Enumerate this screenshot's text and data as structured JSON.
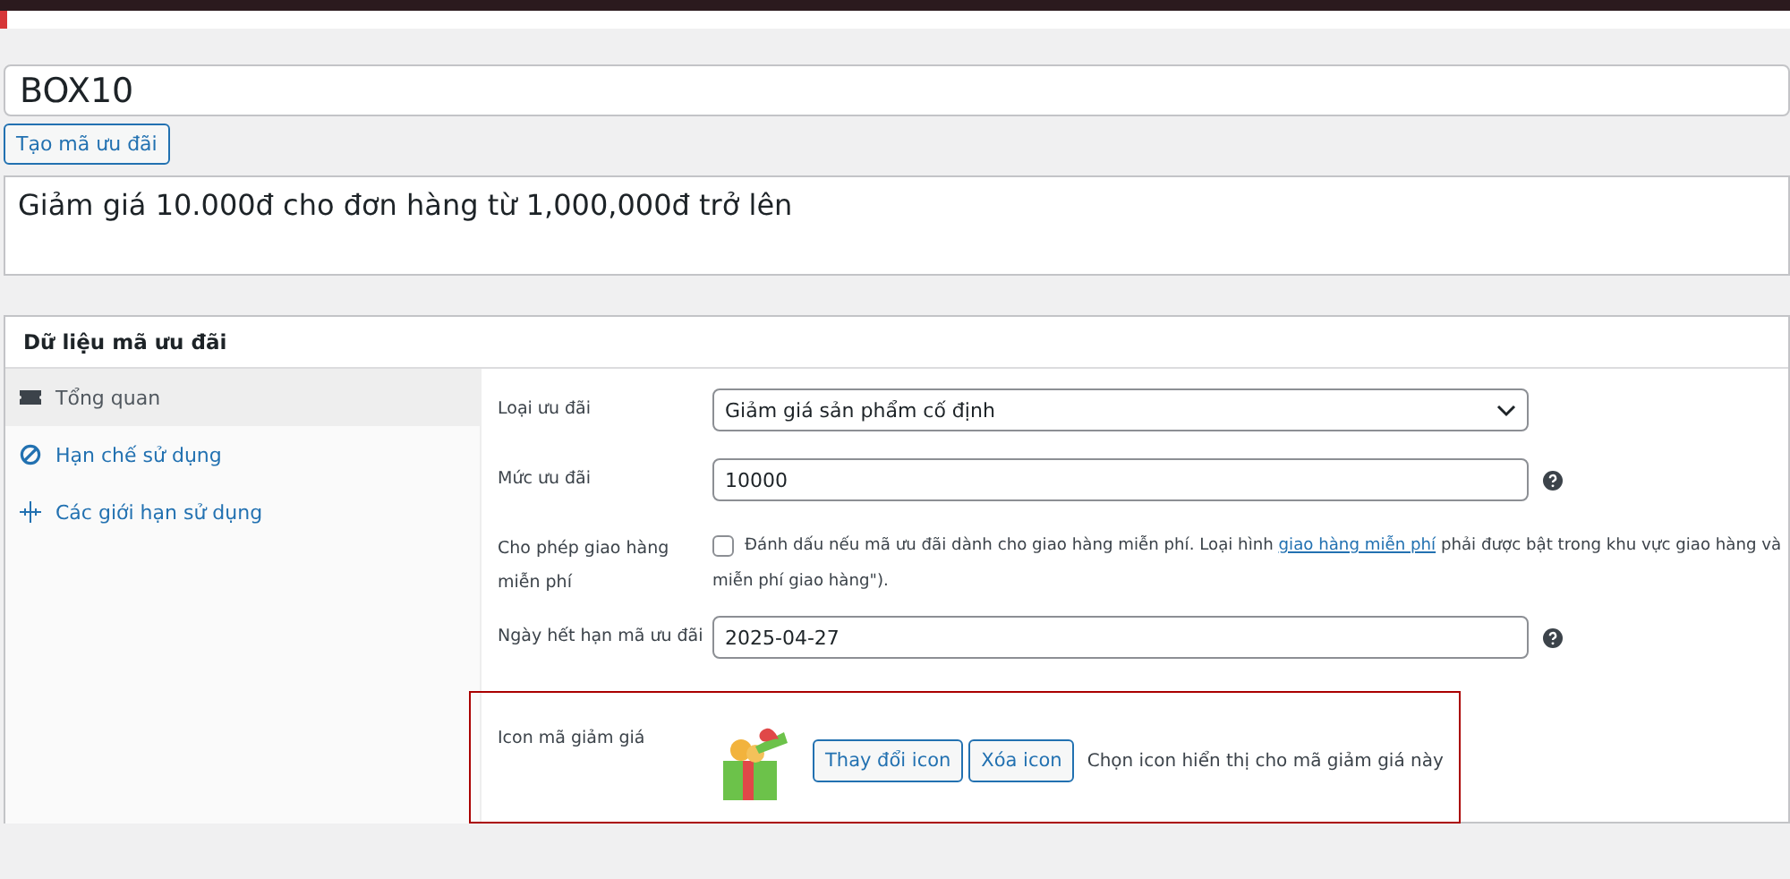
{
  "coupon_code": {
    "value": "BOX10"
  },
  "generate_button": "Tạo mã ưu đãi",
  "description": {
    "value": "Giảm giá 10.000đ cho đơn hàng từ 1,000,000đ trở lên"
  },
  "panel": {
    "title": "Dữ liệu mã ưu đãi",
    "tabs": [
      {
        "label": "Tổng quan",
        "selected": true
      },
      {
        "label": "Hạn chế sử dụng",
        "selected": false
      },
      {
        "label": "Các giới hạn sử dụng",
        "selected": false
      }
    ],
    "fields": [
      {
        "kind": "select",
        "label": "Loại ưu đãi",
        "value": "Giảm giá sản phẩm cố định",
        "help": false
      },
      {
        "kind": "text",
        "label": "Mức ưu đãi",
        "value": "10000",
        "help": true
      },
      {
        "kind": "checkbox",
        "label": "Cho phép giao hàng miễn phí",
        "checked": false,
        "text_before": "Đánh dấu nếu mã ưu đãi dành cho giao hàng miễn phí. Loại hình ",
        "link": "giao hàng miễn phí",
        "text_after": " phải được bật trong khu vực giao hàng và",
        "text_line2": "miễn phí giao hàng\")."
      },
      {
        "kind": "text",
        "label": "Ngày hết hạn mã ưu đãi",
        "value": "2025-04-27",
        "help": true
      },
      {
        "kind": "icon",
        "label": "Icon mã giảm giá",
        "highlighted": true,
        "buttons": [
          "Thay đổi icon",
          "Xóa icon"
        ],
        "hint": "Chọn icon hiển thị cho mã giảm giá này"
      }
    ]
  }
}
